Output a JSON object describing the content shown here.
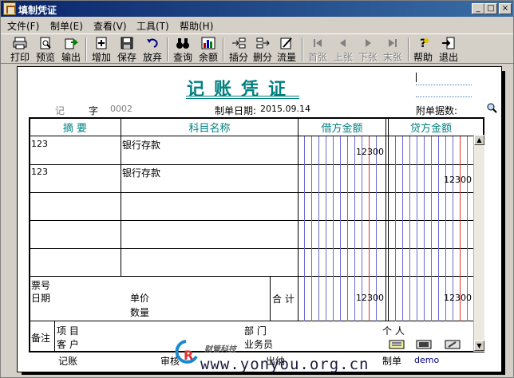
{
  "window": {
    "title": "填制凭证",
    "min": "_",
    "max": "□",
    "close": "×"
  },
  "menu": [
    "文件(F)",
    "制单(E)",
    "查看(V)",
    "工具(T)",
    "帮助(H)"
  ],
  "toolbar": [
    {
      "label": "打印",
      "icon": "print-icon"
    },
    {
      "label": "预览",
      "icon": "preview-icon"
    },
    {
      "label": "输出",
      "icon": "export-icon"
    },
    {
      "label": "增加",
      "icon": "add-icon"
    },
    {
      "label": "保存",
      "icon": "save-icon"
    },
    {
      "label": "放弃",
      "icon": "undo-icon"
    },
    {
      "label": "查询",
      "icon": "binoculars-icon"
    },
    {
      "label": "余额",
      "icon": "balance-chart-icon"
    },
    {
      "label": "插分",
      "icon": "insert-row-icon"
    },
    {
      "label": "删分",
      "icon": "delete-row-icon"
    },
    {
      "label": "流量",
      "icon": "cashflow-icon"
    },
    {
      "label": "首张",
      "icon": "first-icon",
      "disabled": true
    },
    {
      "label": "上张",
      "icon": "prev-icon",
      "disabled": true
    },
    {
      "label": "下张",
      "icon": "next-icon",
      "disabled": true
    },
    {
      "label": "末张",
      "icon": "last-icon",
      "disabled": true
    },
    {
      "label": "帮助",
      "icon": "help-icon"
    },
    {
      "label": "退出",
      "icon": "exit-icon"
    }
  ],
  "voucher": {
    "title": "记账凭证",
    "type_label": "记",
    "number_label": "字",
    "number": "0002",
    "date_label": "制单日期:",
    "date": "2015.09.14",
    "attach_label": "附单据数:",
    "columns": [
      "摘 要",
      "科目名称",
      "借方金额",
      "贷方金额"
    ],
    "rows": [
      {
        "summary": "123",
        "account": "银行存款",
        "debit": "12300",
        "credit": ""
      },
      {
        "summary": "123",
        "account": "银行存款",
        "debit": "",
        "credit": "12300"
      },
      {
        "summary": "",
        "account": "",
        "debit": "",
        "credit": ""
      },
      {
        "summary": "",
        "account": "",
        "debit": "",
        "credit": ""
      },
      {
        "summary": "",
        "account": "",
        "debit": "",
        "credit": ""
      }
    ],
    "bill_no_label": "票号",
    "date2_label": "日期",
    "price_label": "单价",
    "qty_label": "数量",
    "total_label": "合 计",
    "total_debit": "12300",
    "total_credit": "12300",
    "remark_label": "备注",
    "project_label": "项  目",
    "customer_label": "客  户",
    "dept_label": "部  门",
    "person_label": "个  人",
    "salesman_label": "业务员",
    "bookkeeper_label": "记账",
    "auditor_label": "审核",
    "cashier_label": "出纳",
    "maker_label": "制单",
    "maker": "demo"
  },
  "watermark": {
    "text": "www.yonyou.org.cn",
    "small": "财管科技"
  }
}
